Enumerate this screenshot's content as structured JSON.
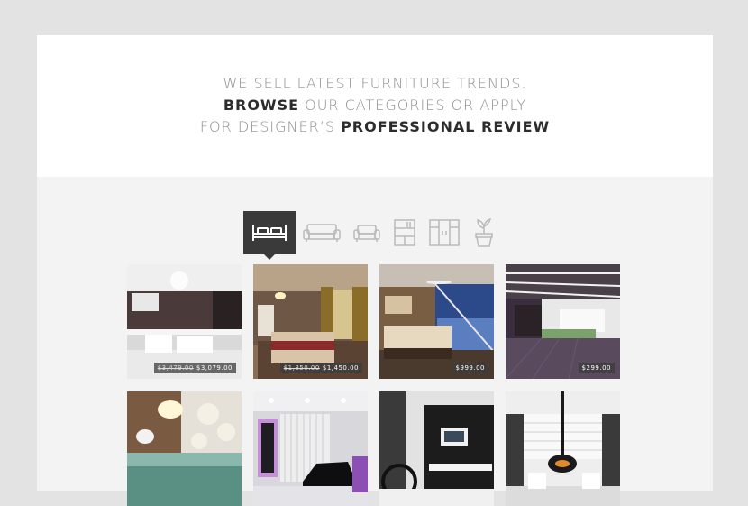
{
  "hero": {
    "line1": "WE SELL LATEST FURNITURE TRENDS.",
    "line2_bold": "BROWSE",
    "line2_rest": " OUR CATEGORIES OR APPLY",
    "line3_rest": "FOR DESIGNER’S ",
    "line3_bold": "PROFESSIONAL REVIEW"
  },
  "tabs": [
    {
      "icon": "bed-icon",
      "active": true
    },
    {
      "icon": "sofa-icon",
      "active": false
    },
    {
      "icon": "armchair-icon",
      "active": false
    },
    {
      "icon": "bookshelf-icon",
      "active": false
    },
    {
      "icon": "wardrobe-icon",
      "active": false
    },
    {
      "icon": "plant-icon",
      "active": false
    }
  ],
  "products": [
    {
      "name": "kitchen",
      "old_price": "$3,479.00",
      "price": "$3,079.00"
    },
    {
      "name": "bedroom-classic",
      "old_price": "$1,850.00",
      "price": "$1,450.00"
    },
    {
      "name": "bedroom-city",
      "old_price": "",
      "price": "$999.00"
    },
    {
      "name": "loft",
      "old_price": "",
      "price": "$299.00"
    },
    {
      "name": "living-room-white",
      "old_price": "",
      "price": ""
    },
    {
      "name": "piano-room",
      "old_price": "",
      "price": ""
    },
    {
      "name": "tv-room",
      "old_price": "",
      "price": ""
    },
    {
      "name": "fireplace-room",
      "old_price": "",
      "price": ""
    }
  ],
  "colors": {
    "background": "#e3e3e3",
    "panel": "#f3f3f3",
    "active_tab": "#3a3a3a",
    "text_light": "#8e8e8e",
    "text_dark": "#2c2c2c"
  }
}
